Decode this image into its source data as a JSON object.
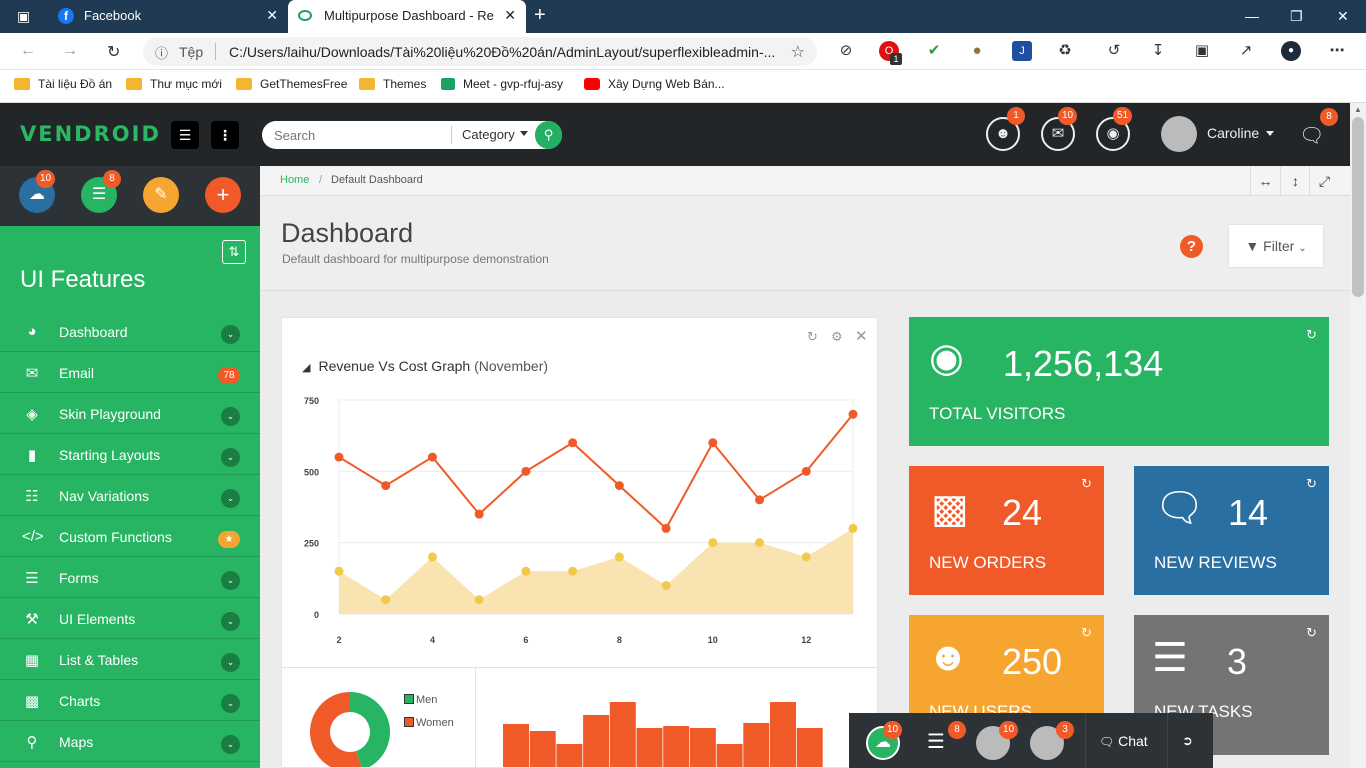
{
  "browser": {
    "tabs": [
      {
        "title": "Facebook"
      },
      {
        "title": "Multipurpose Dashboard - Resp"
      }
    ],
    "address": {
      "scheme_label": "Tệp",
      "url": "C:/Users/laihu/Downloads/Tài%20liệu%20Đồ%20án/AdminLayout/superflexibleadmin-..."
    },
    "bookmarks": [
      {
        "label": "Tài liệu Đồ án",
        "icon": "folder-icon"
      },
      {
        "label": "Thư mục mới",
        "icon": "folder-icon"
      },
      {
        "label": "GetThemesFree",
        "icon": "folder-icon"
      },
      {
        "label": "Themes",
        "icon": "folder-icon"
      },
      {
        "label": "Meet - gvp-rfuj-asy",
        "icon": "meet-icon"
      },
      {
        "label": "Xây Dựng Web Bán...",
        "icon": "youtube-icon"
      }
    ],
    "extension_badge": "1"
  },
  "app": {
    "logo": "VENDROID",
    "search": {
      "placeholder": "Search",
      "category": "Category"
    },
    "top_badges": {
      "users": "1",
      "mail": "10",
      "globe": "51",
      "chat": "8"
    },
    "user_name": "Caroline"
  },
  "sidebar": {
    "quick_badges": {
      "cloud": "10",
      "list": "8"
    },
    "title": "UI Features",
    "items": [
      {
        "label": "Dashboard",
        "icon": "dashboard-icon"
      },
      {
        "label": "Email",
        "icon": "email-icon",
        "badge": "78"
      },
      {
        "label": "Skin Playground",
        "icon": "palette-icon"
      },
      {
        "label": "Starting Layouts",
        "icon": "bookmark-icon"
      },
      {
        "label": "Nav Variations",
        "icon": "sitemap-icon"
      },
      {
        "label": "Custom Functions",
        "icon": "code-icon",
        "badge": "★"
      },
      {
        "label": "Forms",
        "icon": "list-icon"
      },
      {
        "label": "UI Elements",
        "icon": "tools-icon"
      },
      {
        "label": "List & Tables",
        "icon": "table-icon"
      },
      {
        "label": "Charts",
        "icon": "signal-icon"
      },
      {
        "label": "Maps",
        "icon": "map-marker-icon"
      }
    ]
  },
  "breadcrumb": {
    "home": "Home",
    "separator": "/",
    "current": "Default Dashboard"
  },
  "page": {
    "title": "Dashboard",
    "subtitle": "Default dashboard for multipurpose demonstration",
    "filter_label": "Filter",
    "help": "?"
  },
  "chart_card": {
    "title": "Revenue Vs Cost Graph",
    "title_suffix": "(November)"
  },
  "chart_data": {
    "type": "line",
    "title": "Revenue Vs Cost Graph (November)",
    "x": [
      2,
      3,
      4,
      5,
      6,
      7,
      8,
      9,
      10,
      11,
      12,
      13
    ],
    "x_ticks": [
      2,
      4,
      6,
      8,
      10,
      12
    ],
    "y_ticks": [
      0,
      250,
      500,
      750
    ],
    "ylim": [
      0,
      750
    ],
    "grid": true,
    "series": [
      {
        "values": [
          550,
          450,
          550,
          350,
          500,
          600,
          450,
          300,
          600,
          400,
          500,
          700
        ],
        "color": "#f05a28",
        "style": "line"
      },
      {
        "values": [
          150,
          50,
          200,
          50,
          150,
          150,
          200,
          100,
          250,
          250,
          200,
          300
        ],
        "color": "#f2c94c",
        "fill": "#f8e3b1",
        "style": "area"
      }
    ]
  },
  "donut_chart": {
    "type": "pie",
    "legend": [
      "Men",
      "Women"
    ],
    "colors": [
      "#27b463",
      "#f05a28"
    ],
    "values": [
      45,
      55
    ]
  },
  "bar_chart": {
    "type": "bar",
    "color": "#f05a28",
    "values": [
      32,
      25,
      12,
      41,
      54,
      28,
      30,
      28,
      12,
      33,
      54,
      28
    ],
    "ylim": [
      0,
      70
    ]
  },
  "stats": [
    {
      "value": "1,256,134",
      "label": "TOTAL VISITORS",
      "color": "#27b463",
      "icon": "globe-icon"
    },
    {
      "value": "24",
      "label": "NEW ORDERS",
      "color": "#f05a28",
      "icon": "bar-chart-icon"
    },
    {
      "value": "14",
      "label": "NEW REVIEWS",
      "color": "#2a6fa1",
      "icon": "comments-icon"
    },
    {
      "value": "250",
      "label": "NEW USERS",
      "color": "#f7a531",
      "icon": "users-icon"
    },
    {
      "value": "3",
      "label": "NEW TASKS",
      "color": "#747474",
      "icon": "tasks-icon"
    }
  ],
  "chat_bar": {
    "label": "Chat",
    "badges": [
      "10",
      "8",
      "10",
      "3"
    ]
  }
}
